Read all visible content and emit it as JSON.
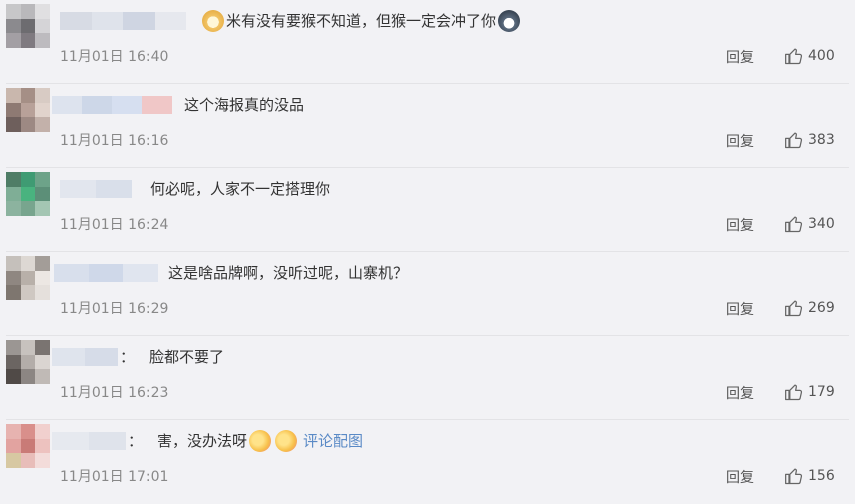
{
  "comments": [
    {
      "text": "米有没有要猴不知道，但猴一定会冲了你",
      "emoji_before": "dog-face-emoji",
      "emoji_after": "husky-emoji",
      "time": "11月01日 16:40",
      "reply": "回复",
      "likes": "400",
      "avatar_colors": [
        "#c7c7c9",
        "#b9b8bb",
        "#e0dfe1",
        "#8b8a8e",
        "#6d6c70",
        "#d5d4d7",
        "#a39fa4",
        "#7f7a80",
        "#bdbbbf"
      ],
      "name_colors": [
        "#d7dbe4",
        "#dfe3eb",
        "#cfd5e2",
        "#e6e8ee"
      ]
    },
    {
      "text": "这个海报真的没品",
      "time": "11月01日 16:16",
      "reply": "回复",
      "likes": "383",
      "avatar_colors": [
        "#c9b7ad",
        "#a58f86",
        "#d8cbc4",
        "#8e7a73",
        "#b8a199",
        "#e1d3cc",
        "#6e5f5c",
        "#9d8983",
        "#c3b1aa"
      ],
      "name_colors": [
        "#dde3ee",
        "#cdd7e8",
        "#d6dff0",
        "#f0c7c7"
      ]
    },
    {
      "text": "何必呢，人家不一定搭理你",
      "time": "11月01日 16:24",
      "reply": "回复",
      "likes": "340",
      "avatar_colors": [
        "#4f7d66",
        "#3f9b73",
        "#6da389",
        "#7fae96",
        "#49b37f",
        "#5c8f78",
        "#8cb39f",
        "#78a58e",
        "#a4c6b3"
      ],
      "name_colors": [
        "#e2e6ee",
        "#d9dfea"
      ]
    },
    {
      "text": "这是啥品牌啊，没听过呢，山寨机？",
      "time": "11月01日 16:29",
      "reply": "回复",
      "likes": "269",
      "avatar_colors": [
        "#c5c0bb",
        "#ddd8d3",
        "#a39d98",
        "#8f8781",
        "#b8b0a9",
        "#ece7e3",
        "#7e766f",
        "#cfc8c2",
        "#e5e0dc"
      ],
      "name_colors": [
        "#d8dfec",
        "#cfd8e9",
        "#e0e5ef"
      ]
    },
    {
      "text": "脸都不要了",
      "colon": "：",
      "time": "11月01日 16:23",
      "reply": "回复",
      "likes": "179",
      "avatar_colors": [
        "#9b9693",
        "#c7c2be",
        "#7a7471",
        "#6b6562",
        "#b3ada9",
        "#dad5d1",
        "#504a47",
        "#8c8683",
        "#c0bab6"
      ],
      "name_colors": [
        "#dfe4ed",
        "#d6dce8"
      ]
    },
    {
      "text": "害，没办法呀",
      "colon": "：",
      "link": "评论配图",
      "time": "11月01日 17:01",
      "reply": "回复",
      "likes": "156",
      "avatar_colors": [
        "#e7b3b0",
        "#d98f8b",
        "#f1d0ce",
        "#e2a3a0",
        "#c97b77",
        "#edc2bf",
        "#d7c8a2",
        "#e8bdb9",
        "#f3dcda"
      ],
      "name_colors": [
        "#e6e9ef",
        "#dfe3eb"
      ]
    }
  ]
}
